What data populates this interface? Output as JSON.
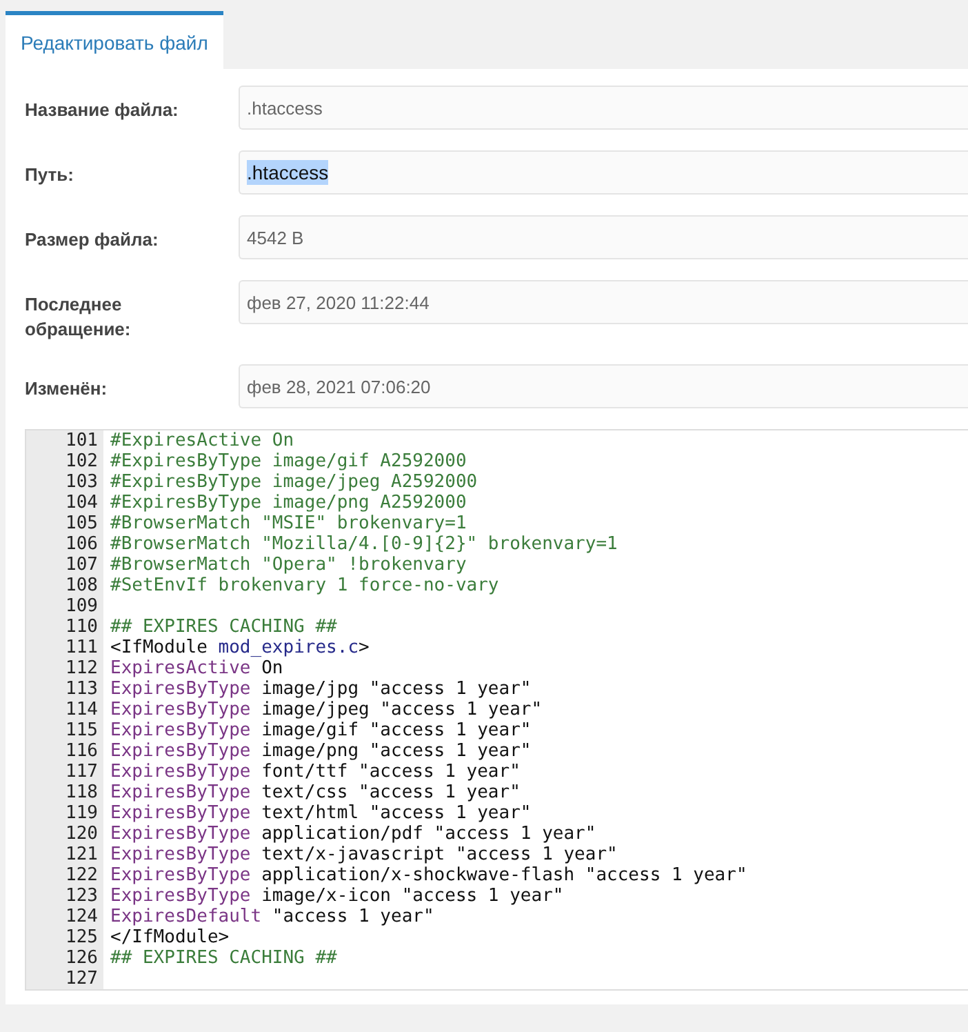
{
  "tabs": [
    {
      "label": "Редактировать файл",
      "selected": true
    }
  ],
  "fields": [
    {
      "label": "Название файла:",
      "value": ".htaccess",
      "selected_text": false
    },
    {
      "label": "Путь:",
      "value": ".htaccess",
      "selected_text": true
    },
    {
      "label": "Размер файла:",
      "value": "4542 B",
      "selected_text": false
    },
    {
      "label": "Последнее обращение:",
      "value": "фев 27, 2020 11:22:44",
      "selected_text": false
    },
    {
      "label": "Изменён:",
      "value": "фев 28, 2021 07:06:20",
      "selected_text": false
    }
  ],
  "editor": {
    "lines": [
      {
        "number": "101",
        "tokens": [
          {
            "kind": "comment",
            "text": "#ExpiresActive On"
          }
        ]
      },
      {
        "number": "102",
        "tokens": [
          {
            "kind": "comment",
            "text": "#ExpiresByType image/gif A2592000"
          }
        ]
      },
      {
        "number": "103",
        "tokens": [
          {
            "kind": "comment",
            "text": "#ExpiresByType image/jpeg A2592000"
          }
        ]
      },
      {
        "number": "104",
        "tokens": [
          {
            "kind": "comment",
            "text": "#ExpiresByType image/png A2592000"
          }
        ]
      },
      {
        "number": "105",
        "tokens": [
          {
            "kind": "comment",
            "text": "#BrowserMatch \"MSIE\" brokenvary=1"
          }
        ]
      },
      {
        "number": "106",
        "tokens": [
          {
            "kind": "comment",
            "text": "#BrowserMatch \"Mozilla/4.[0-9]{2}\" brokenvary=1"
          }
        ]
      },
      {
        "number": "107",
        "tokens": [
          {
            "kind": "comment",
            "text": "#BrowserMatch \"Opera\" !brokenvary"
          }
        ]
      },
      {
        "number": "108",
        "tokens": [
          {
            "kind": "comment",
            "text": "#SetEnvIf brokenvary 1 force-no-vary"
          }
        ]
      },
      {
        "number": "109"
      },
      {
        "number": "110",
        "tokens": [
          {
            "kind": "comment",
            "text": "## EXPIRES CACHING ##"
          }
        ]
      },
      {
        "number": "111",
        "tokens": [
          {
            "kind": "plain",
            "text": "<IfModule "
          },
          {
            "kind": "module",
            "text": "mod_expires.c"
          },
          {
            "kind": "plain",
            "text": ">"
          }
        ]
      },
      {
        "number": "112",
        "tokens": [
          {
            "kind": "keyword",
            "text": "ExpiresActive"
          },
          {
            "kind": "plain",
            "text": " On"
          }
        ]
      },
      {
        "number": "113",
        "tokens": [
          {
            "kind": "keyword",
            "text": "ExpiresByType"
          },
          {
            "kind": "plain",
            "text": " image/jpg \"access 1 year\""
          }
        ]
      },
      {
        "number": "114",
        "tokens": [
          {
            "kind": "keyword",
            "text": "ExpiresByType"
          },
          {
            "kind": "plain",
            "text": " image/jpeg \"access 1 year\""
          }
        ]
      },
      {
        "number": "115",
        "tokens": [
          {
            "kind": "keyword",
            "text": "ExpiresByType"
          },
          {
            "kind": "plain",
            "text": " image/gif \"access 1 year\""
          }
        ]
      },
      {
        "number": "116",
        "tokens": [
          {
            "kind": "keyword",
            "text": "ExpiresByType"
          },
          {
            "kind": "plain",
            "text": " image/png \"access 1 year\""
          }
        ]
      },
      {
        "number": "117",
        "tokens": [
          {
            "kind": "keyword",
            "text": "ExpiresByType"
          },
          {
            "kind": "plain",
            "text": " font/ttf \"access 1 year\""
          }
        ]
      },
      {
        "number": "118",
        "tokens": [
          {
            "kind": "keyword",
            "text": "ExpiresByType"
          },
          {
            "kind": "plain",
            "text": " text/css \"access 1 year\""
          }
        ]
      },
      {
        "number": "119",
        "tokens": [
          {
            "kind": "keyword",
            "text": "ExpiresByType"
          },
          {
            "kind": "plain",
            "text": " text/html \"access 1 year\""
          }
        ]
      },
      {
        "number": "120",
        "tokens": [
          {
            "kind": "keyword",
            "text": "ExpiresByType"
          },
          {
            "kind": "plain",
            "text": " application/pdf \"access 1 year\""
          }
        ]
      },
      {
        "number": "121",
        "tokens": [
          {
            "kind": "keyword",
            "text": "ExpiresByType"
          },
          {
            "kind": "plain",
            "text": " text/x-javascript \"access 1 year\""
          }
        ]
      },
      {
        "number": "122",
        "tokens": [
          {
            "kind": "keyword",
            "text": "ExpiresByType"
          },
          {
            "kind": "plain",
            "text": " application/x-shockwave-flash \"access 1 year\""
          }
        ]
      },
      {
        "number": "123",
        "tokens": [
          {
            "kind": "keyword",
            "text": "ExpiresByType"
          },
          {
            "kind": "plain",
            "text": " image/x-icon \"access 1 year\""
          }
        ]
      },
      {
        "number": "124",
        "tokens": [
          {
            "kind": "keyword",
            "text": "ExpiresDefault"
          },
          {
            "kind": "plain",
            "text": " \"access 1 year\""
          }
        ]
      },
      {
        "number": "125",
        "tokens": [
          {
            "kind": "plain",
            "text": "</IfModule>"
          }
        ]
      },
      {
        "number": "126",
        "tokens": [
          {
            "kind": "comment",
            "text": "## EXPIRES CACHING ##"
          }
        ]
      },
      {
        "number": "127"
      }
    ]
  }
}
